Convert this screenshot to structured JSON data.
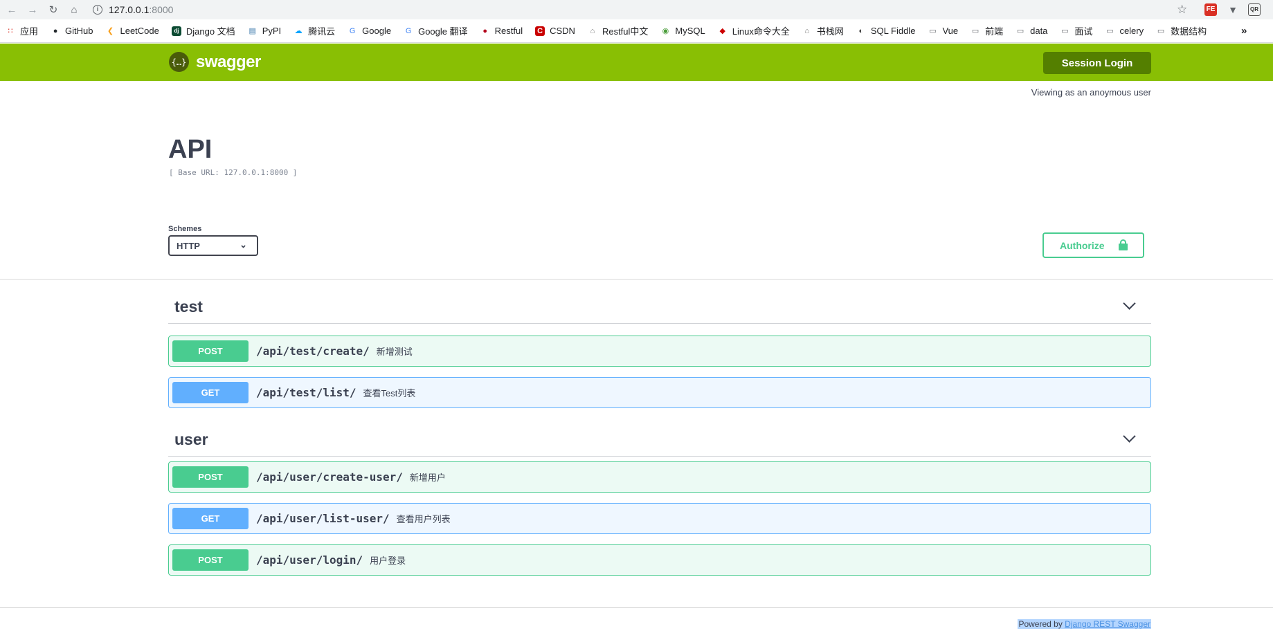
{
  "browser": {
    "url_host": "127.0.0.1",
    "url_port": ":8000",
    "bookmarks": [
      {
        "label": "应用",
        "icon": "apps-grid-icon",
        "color": "#d93025"
      },
      {
        "label": "GitHub",
        "icon": "github-icon",
        "color": "#24292e"
      },
      {
        "label": "LeetCode",
        "icon": "leetcode-icon",
        "color": "#f89f1b"
      },
      {
        "label": "Django 文档",
        "icon": "django-icon",
        "color": "#0c4b33"
      },
      {
        "label": "PyPI",
        "icon": "pypi-icon",
        "color": "#3775a9"
      },
      {
        "label": "腾讯云",
        "icon": "tencent-cloud-icon",
        "color": "#00a3ff"
      },
      {
        "label": "Google",
        "icon": "google-icon",
        "color": "#4285f4"
      },
      {
        "label": "Google 翻译",
        "icon": "google-translate-icon",
        "color": "#4285f4"
      },
      {
        "label": "Restful",
        "icon": "restful-icon",
        "color": "#b3001b"
      },
      {
        "label": "CSDN",
        "icon": "csdn-icon",
        "color": "#c90000"
      },
      {
        "label": "Restful中文",
        "icon": "restful-cn-icon",
        "color": "#777777"
      },
      {
        "label": "MySQL",
        "icon": "mysql-icon",
        "color": "#4a9d3a"
      },
      {
        "label": "Linux命令大全",
        "icon": "linux-icon",
        "color": "#cc0000"
      },
      {
        "label": "书栈网",
        "icon": "bookstack-icon",
        "color": "#777777"
      },
      {
        "label": "SQL Fiddle",
        "icon": "sqlfiddle-icon",
        "color": "#333333"
      },
      {
        "label": "Vue",
        "icon": "folder-icon",
        "color": "#5f6368"
      },
      {
        "label": "前端",
        "icon": "folder-icon",
        "color": "#5f6368"
      },
      {
        "label": "data",
        "icon": "folder-icon",
        "color": "#5f6368"
      },
      {
        "label": "面试",
        "icon": "folder-icon",
        "color": "#5f6368"
      },
      {
        "label": "celery",
        "icon": "folder-icon",
        "color": "#5f6368"
      },
      {
        "label": "数据结构",
        "icon": "folder-icon",
        "color": "#5f6368"
      }
    ],
    "bookmarks_more": "»"
  },
  "header": {
    "logo_text": "swagger",
    "logo_glyph": "{…}",
    "session_login": "Session Login",
    "viewing_as": "Viewing as an anoymous user",
    "accent_color": "#89bf04"
  },
  "info": {
    "title": "API",
    "base_url": "[ Base URL: 127.0.0.1:8000 ]"
  },
  "schemes": {
    "label": "Schemes",
    "selected": "HTTP"
  },
  "authorize": {
    "label": "Authorize"
  },
  "tags": [
    {
      "name": "test",
      "operations": [
        {
          "method": "POST",
          "path": "/api/test/create/",
          "summary": "新增测试"
        },
        {
          "method": "GET",
          "path": "/api/test/list/",
          "summary": "查看Test列表"
        }
      ]
    },
    {
      "name": "user",
      "operations": [
        {
          "method": "POST",
          "path": "/api/user/create-user/",
          "summary": "新增用户"
        },
        {
          "method": "GET",
          "path": "/api/user/list-user/",
          "summary": "查看用户列表"
        },
        {
          "method": "POST",
          "path": "/api/user/login/",
          "summary": "用户登录"
        }
      ]
    }
  ],
  "footer": {
    "prefix": "Powered by ",
    "link": "Django REST Swagger"
  }
}
